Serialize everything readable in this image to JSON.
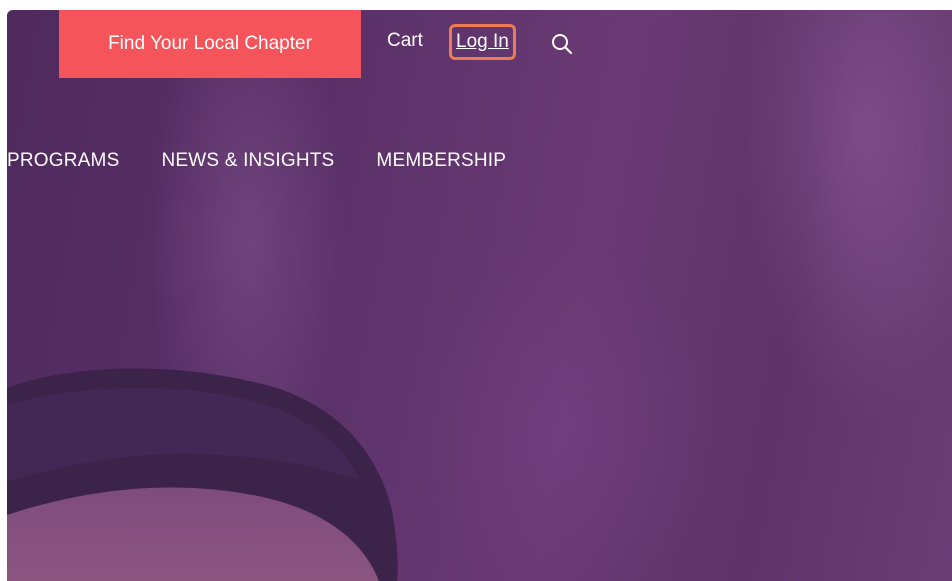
{
  "header": {
    "chapter_button_label": "Find Your Local Chapter",
    "cart_label": "Cart",
    "login_label": "Log In",
    "search_icon": "search-icon"
  },
  "nav": {
    "items": [
      {
        "label": "PROGRAMS"
      },
      {
        "label": "NEWS & INSIGHTS"
      },
      {
        "label": "MEMBERSHIP"
      }
    ]
  },
  "colors": {
    "accent": "#f5545a",
    "highlight_outline": "#ee7b52",
    "hero_tint": "#5a2f66"
  },
  "hero": {
    "image_icon": "person-photo"
  }
}
